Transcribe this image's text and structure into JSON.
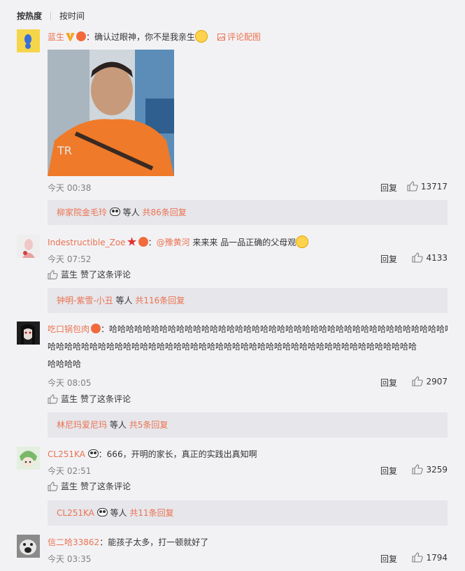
{
  "sort": {
    "hot": "按热度",
    "time": "按时间"
  },
  "labels": {
    "reply": "回复",
    "liked_suffix": "赞了这条评论",
    "others": "等人",
    "pic_link": "评论配图"
  },
  "comments": [
    {
      "user": "蓝生",
      "text": "：确认过眼神，你不是我亲生",
      "time": "今天 00:38",
      "likes": "13717",
      "sub_user": "柳家院金毛玲",
      "sub_total": "共86条回复"
    },
    {
      "user": "Indestructible_Zoe",
      "text_pre": "：",
      "mention": "@豫黄河",
      "text": " 来来来 品一品正确的父母观",
      "time": "今天 07:52",
      "likes": "4133",
      "liker": "蓝生",
      "sub_user": "钟明-紫雪-小丑",
      "sub_total": "共116条回复"
    },
    {
      "user": "吃口锅包肉",
      "text_line1": "：哈哈哈哈哈哈哈哈哈哈哈哈哈哈哈哈哈哈哈哈哈哈哈哈哈哈哈哈哈哈哈哈哈哈哈哈哈哈哈哈哈哈哈",
      "text_line2": "哈哈哈哈哈哈哈哈哈哈哈哈哈哈哈哈哈哈哈哈哈哈哈哈哈哈哈哈哈哈哈哈哈哈哈哈哈哈哈哈哈哈哈哈",
      "text_line3": "哈哈哈哈",
      "time": "今天 08:05",
      "likes": "2907",
      "liker": "蓝生",
      "sub_user": "林尼玛爱尼玛",
      "sub_total": "共5条回复"
    },
    {
      "user": "CL251KA",
      "text": "：666，开明的家长，真正的实践出真知啊",
      "time": "今天 02:51",
      "likes": "3259",
      "liker": "蓝生",
      "sub_user": "CL251KA",
      "sub_total": "共11条回复"
    },
    {
      "user": "信二哈33862",
      "text": "：能孩子太多，打一顿就好了",
      "time": "今天 03:35",
      "likes": "1794"
    }
  ]
}
